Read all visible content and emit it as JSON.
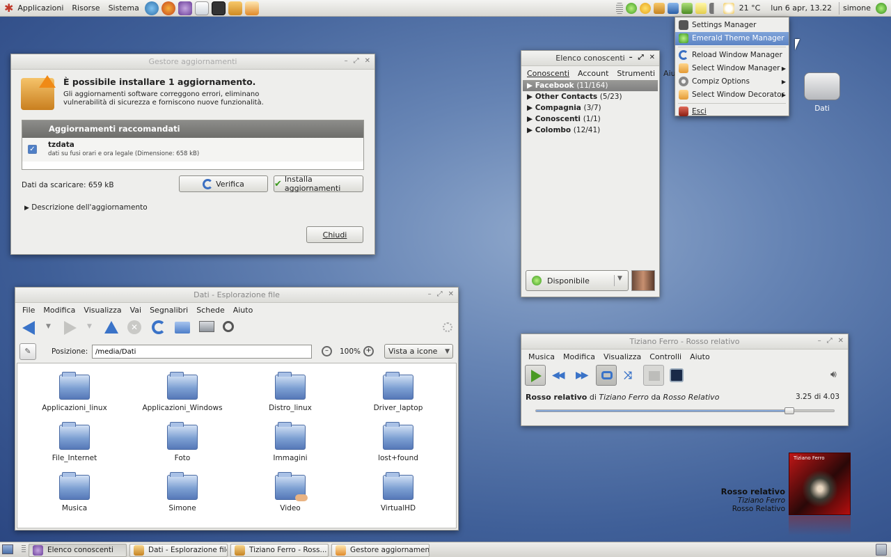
{
  "panel": {
    "applications": "Applicazioni",
    "places": "Risorse",
    "system": "Sistema",
    "temperature": "21 °C",
    "datetime": "lun  6 apr, 13.22",
    "user": "simone"
  },
  "popup": {
    "items": [
      "Settings Manager",
      "Emerald Theme Manager",
      "Reload Window Manager",
      "Select Window Manager",
      "Compiz Options",
      "Select Window Decorator",
      "Esci"
    ]
  },
  "desktop_icon": {
    "label": "Dati"
  },
  "updater": {
    "title": "Gestore aggiornamenti",
    "heading": "È possibile installare 1 aggiornamento.",
    "description": "Gli aggiornamenti software correggono errori, eliminano\nvulnerabilità di sicurezza e forniscono nuove funzionalità.",
    "section": "Aggiornamenti raccomandati",
    "package": "tzdata",
    "package_desc": "dati su fusi orari e ora legale (Dimensione: 658 kB)",
    "download": "Dati da scaricare: 659 kB",
    "verify": "Verifica",
    "install": "Installa aggiornamenti",
    "details": "Descrizione dell'aggiornamento",
    "close": "Chiudi"
  },
  "contacts": {
    "title": "Elenco conoscenti",
    "menu": [
      "Conoscenti",
      "Account",
      "Strumenti",
      "Aiuto"
    ],
    "groups": [
      {
        "name": "Facebook",
        "count": "(11/164)"
      },
      {
        "name": "Other Contacts",
        "count": "(5/23)"
      },
      {
        "name": "Compagnia",
        "count": "(3/7)"
      },
      {
        "name": "Conoscenti",
        "count": "(1/1)"
      },
      {
        "name": "Colombo",
        "count": "(12/41)"
      }
    ],
    "status": "Disponibile"
  },
  "files": {
    "title": "Dati - Esplorazione file",
    "menu": [
      "File",
      "Modifica",
      "Visualizza",
      "Vai",
      "Segnalibri",
      "Schede",
      "Aiuto"
    ],
    "location_label": "Posizione:",
    "location": "/media/Dati",
    "zoom": "100%",
    "view": "Vista a icone",
    "folders": [
      "Applicazioni_linux",
      "Applicazioni_Windows",
      "Distro_linux",
      "Driver_laptop",
      "File_Internet",
      "Foto",
      "Immagini",
      "lost+found",
      "Musica",
      "Simone",
      "Video",
      "VirtualHD"
    ]
  },
  "player": {
    "title": "Tiziano Ferro - Rosso relativo",
    "menu": [
      "Musica",
      "Modifica",
      "Visualizza",
      "Controlli",
      "Aiuto"
    ],
    "track": "Rosso relativo",
    "by": "di",
    "artist": "Tiziano Ferro",
    "from": "da",
    "album": "Rosso Relativo",
    "time": "3.25 di 4.03",
    "progress": 0.85
  },
  "album_widget": {
    "title": "Rosso relativo",
    "artist": "Tiziano Ferro",
    "album": "Rosso Relativo",
    "cover_text": "Tiziano Ferro"
  },
  "taskbar": {
    "tasks": [
      "Elenco conoscenti",
      "Dati - Esplorazione file",
      "Tiziano Ferro - Ross...",
      "Gestore aggiornamenti"
    ]
  }
}
